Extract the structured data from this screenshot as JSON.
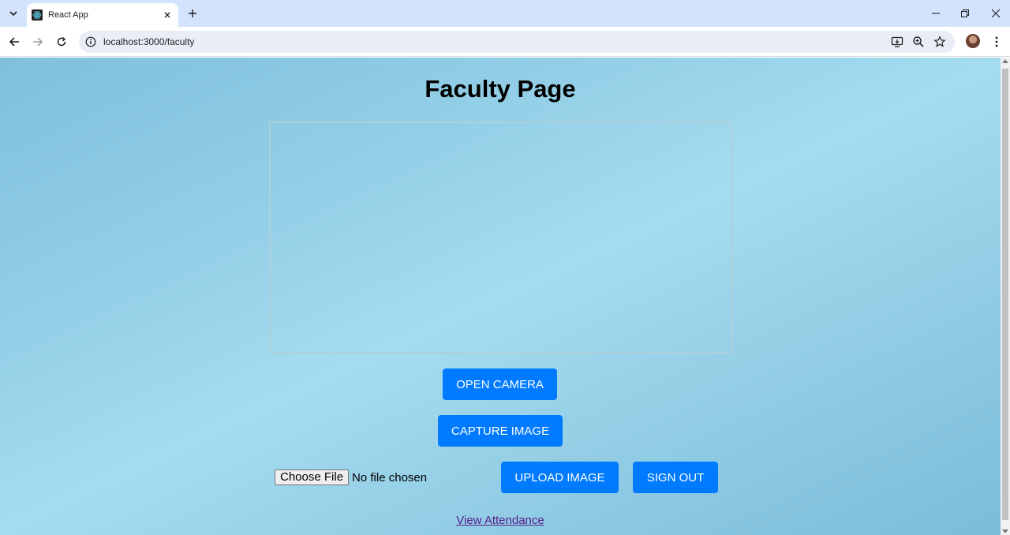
{
  "browser": {
    "tab_title": "React App",
    "url": "localhost:3000/faculty"
  },
  "page": {
    "title": "Faculty Page",
    "buttons": {
      "open_camera": "OPEN CAMERA",
      "capture_image": "CAPTURE IMAGE",
      "upload_image": "UPLOAD IMAGE",
      "sign_out": "SIGN OUT"
    },
    "file_input": {
      "button_label": "Choose File",
      "status": "No file chosen"
    },
    "view_attendance_link": "View Attendance"
  },
  "colors": {
    "primary_button": "#007bff",
    "link": "#551a8b"
  }
}
